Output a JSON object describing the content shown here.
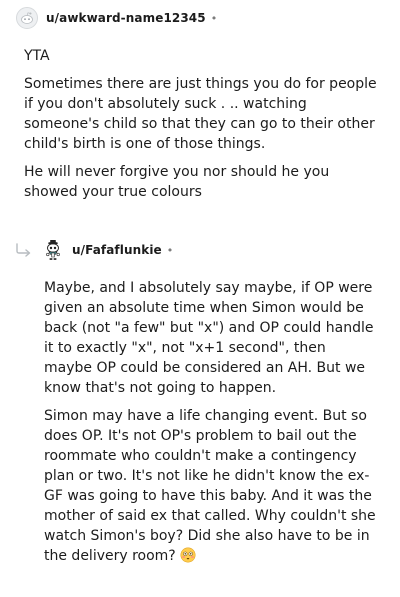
{
  "comments": [
    {
      "username": "u/awkward-name12345",
      "separator": "•",
      "avatar_icon": "default-snoo-avatar-icon",
      "paragraphs": [
        "YTA",
        "Sometimes there are just things you do for people if you don't absolutely suck . .. watching someone's child so that they can go to their other child's birth is one of those things.",
        "He will never forgive you nor should he you showed your true colours"
      ]
    },
    {
      "username": "u/Fafaflunkie",
      "separator": "•",
      "avatar_icon": "snoo-avatar-icon",
      "reply_icon": "reply-arrow-icon",
      "paragraphs": [
        "Maybe, and I absolutely say maybe, if OP were given an absolute time when Simon would be back (not \"a few\" but \"x\") and OP could handle it to exactly \"x\", not \"x+1 second\", then maybe OP could be considered an AH. But we know that's not going to happen.",
        "Simon may have a life changing event. But so does OP. It's not OP's problem to bail out the roommate who couldn't make a contingency plan or two. It's not like he didn't know the ex-GF was going to have this baby. And it was the mother of said ex that called. Why couldn't she watch Simon's boy? Did she also have to be in the delivery room?"
      ],
      "trailing_emoji": "flushed-face-emoji-icon"
    }
  ],
  "colors": {
    "text": "#1c1c1c",
    "meta": "#7c7c7c",
    "emoji_face": "#ffcc4d"
  }
}
